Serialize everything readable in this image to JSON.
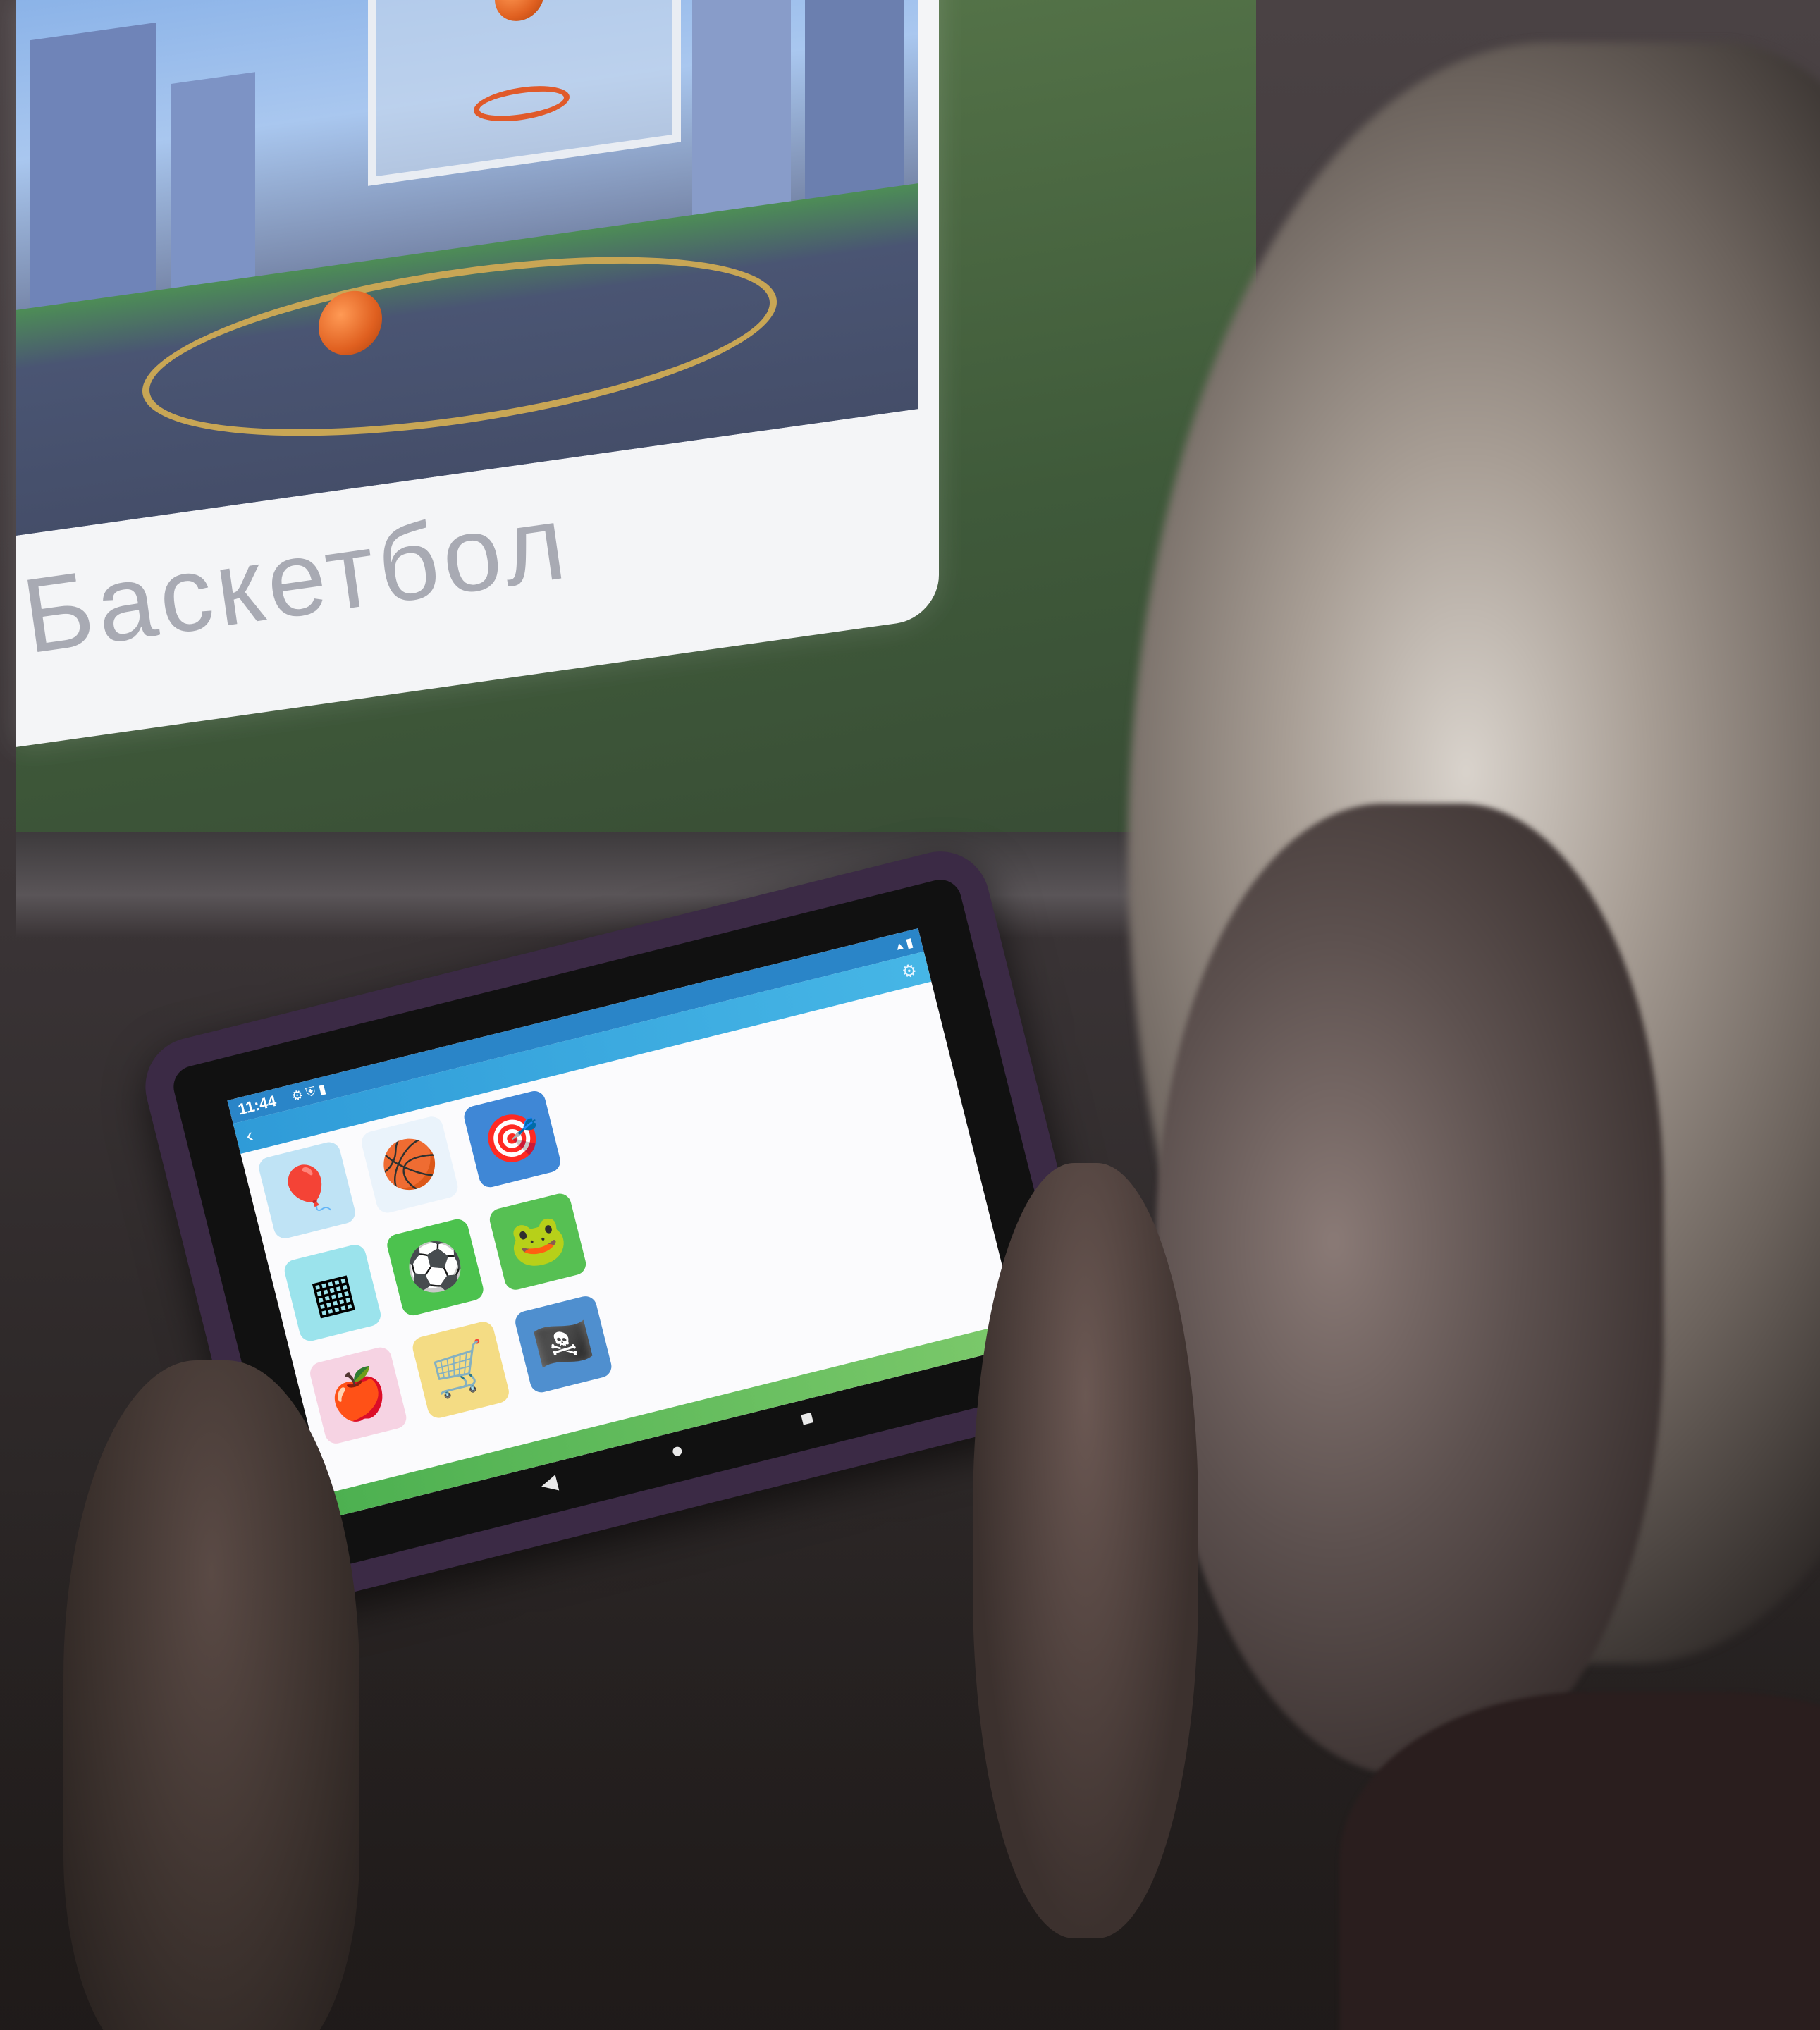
{
  "projection": {
    "title": "Баскетбол",
    "copyright": ""
  },
  "tablet": {
    "status": {
      "time": "11:44",
      "icons": "⚙ ⛨ ▮",
      "right_icons": "▴ ▮"
    },
    "app_bar": {
      "title": "",
      "back_icon": "back-arrow-icon",
      "settings_icon": "gear-icon"
    },
    "tiles": [
      {
        "icon": "balloons-icon",
        "glyph": "🎈",
        "color": "#bfe3f5",
        "label": ""
      },
      {
        "icon": "basketball-icon",
        "glyph": "🏀",
        "color": "#eaf3fb",
        "label": ""
      },
      {
        "icon": "target-icon",
        "glyph": "🎯",
        "color": "#3f87d6",
        "label": ""
      },
      {
        "icon": "shapes-icon",
        "glyph": "▦",
        "color": "#9be3ec",
        "label": ""
      },
      {
        "icon": "soccer-ball-icon",
        "glyph": "⚽",
        "color": "#4cc24e",
        "label": ""
      },
      {
        "icon": "frog-icon",
        "glyph": "🐸",
        "color": "#56c053",
        "label": ""
      },
      {
        "icon": "picture-card-icon",
        "glyph": "🍎",
        "color": "#f6d3e3",
        "label": ""
      },
      {
        "icon": "treasure-cart-icon",
        "glyph": "🛒",
        "color": "#f4dc84",
        "label": ""
      },
      {
        "icon": "pirate-icon",
        "glyph": "🏴‍☠️",
        "color": "#4f8fcf",
        "label": ""
      }
    ],
    "nav": {
      "back": "◀",
      "home": "●",
      "recent": "■"
    }
  },
  "colors": {
    "status_bar": "#2a85c8",
    "app_bar": "#46b6e6",
    "nav_accent": "#4cb050",
    "case": "#3b2a45"
  }
}
